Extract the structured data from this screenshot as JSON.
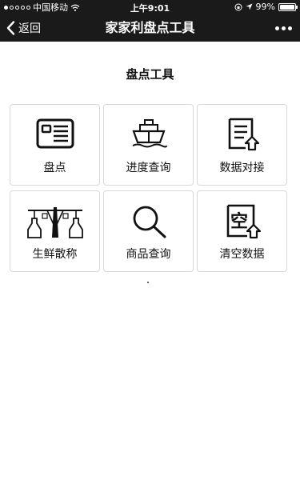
{
  "status_bar": {
    "carrier": "中国移动",
    "time": "上午9:01",
    "battery": "99%",
    "battery_level": 0.99
  },
  "nav": {
    "back_label": "返回",
    "title": "家家利盘点工具"
  },
  "page": {
    "title": "盘点工具"
  },
  "tiles": [
    {
      "label": "盘点",
      "icon": "inventory-card-icon"
    },
    {
      "label": "进度查询",
      "icon": "ship-icon"
    },
    {
      "label": "数据对接",
      "icon": "document-upload-icon"
    },
    {
      "label": "生鲜散称",
      "icon": "scale-bottles-icon"
    },
    {
      "label": "商品查询",
      "icon": "magnifier-icon"
    },
    {
      "label": "清空数据",
      "icon": "clear-document-icon"
    }
  ]
}
